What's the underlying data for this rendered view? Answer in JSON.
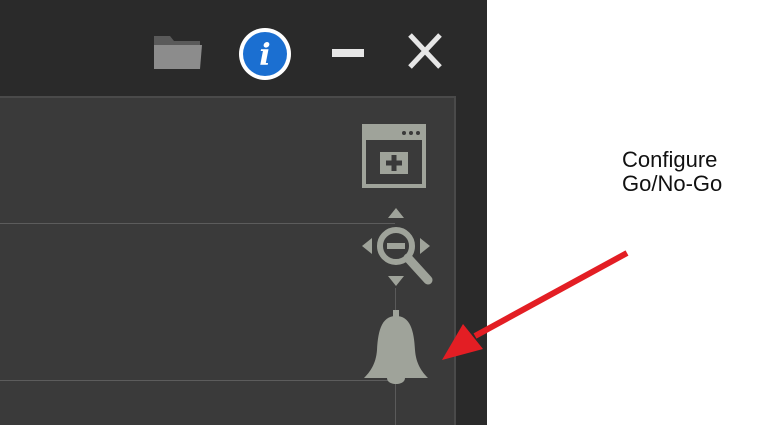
{
  "titlebar": {
    "icons": [
      "folder-icon",
      "info-icon",
      "minimize-icon",
      "close-icon"
    ],
    "info_glyph": "i"
  },
  "toolbar": {
    "icons": [
      "add-window-icon",
      "zoom-pan-icon",
      "bell-icon"
    ]
  },
  "annotation": {
    "line1": "Configure",
    "line2": "Go/No-Go",
    "arrow_color": "#e31e24"
  },
  "colors": {
    "window_bg": "#2a2a2a",
    "panel_bg": "#3a3a3a",
    "icon_gray": "#9fa39a",
    "info_blue": "#1b6fd1"
  }
}
